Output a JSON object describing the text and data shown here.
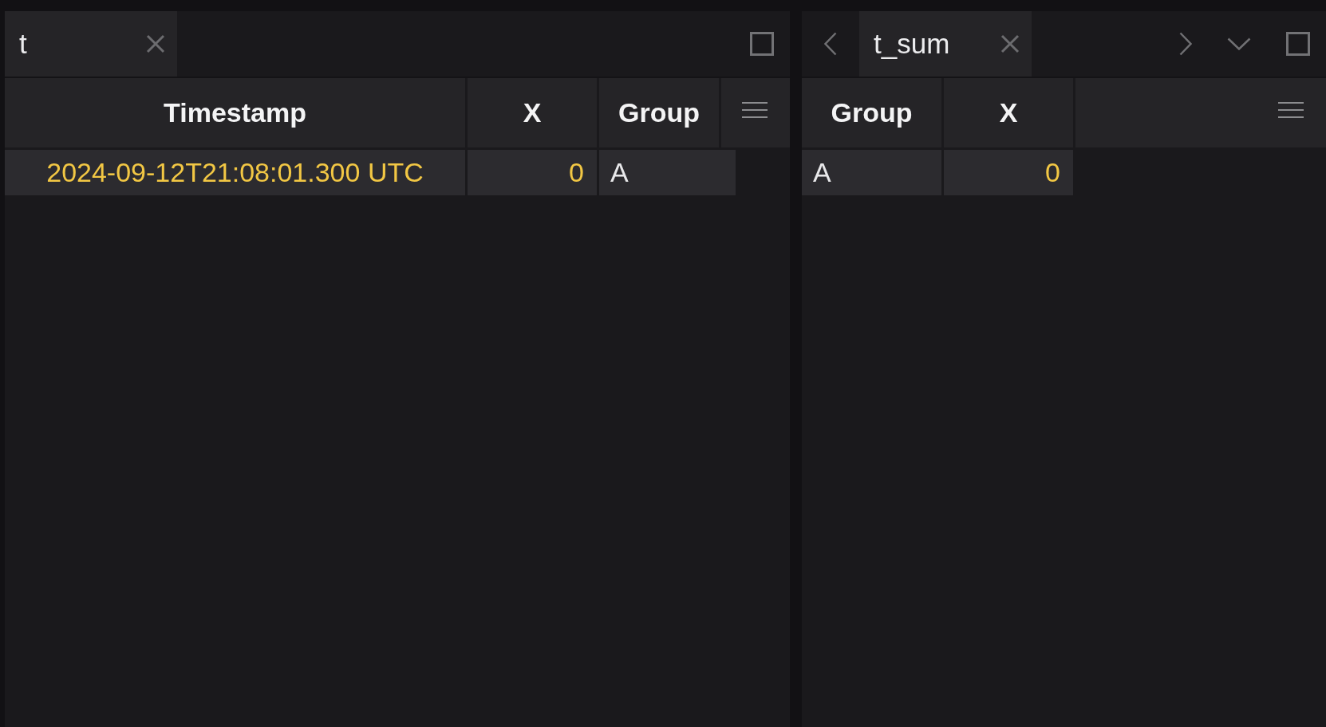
{
  "panels": [
    {
      "tabs": [
        {
          "label": "t",
          "selected": true
        }
      ],
      "overflow_controls": false,
      "table": {
        "columns": [
          {
            "label": "Timestamp",
            "kind": "datetime"
          },
          {
            "label": "X",
            "kind": "number"
          },
          {
            "label": "Group",
            "kind": "string"
          }
        ],
        "rows": [
          {
            "cells": [
              "2024-09-12T21:08:01.300 UTC",
              "0",
              "A"
            ]
          }
        ]
      }
    },
    {
      "tabs": [
        {
          "label": "t_sum",
          "selected": true
        }
      ],
      "overflow_controls": true,
      "table": {
        "columns": [
          {
            "label": "Group",
            "kind": "string"
          },
          {
            "label": "X",
            "kind": "number"
          }
        ],
        "rows": [
          {
            "cells": [
              "A",
              "0"
            ]
          }
        ]
      }
    }
  ]
}
